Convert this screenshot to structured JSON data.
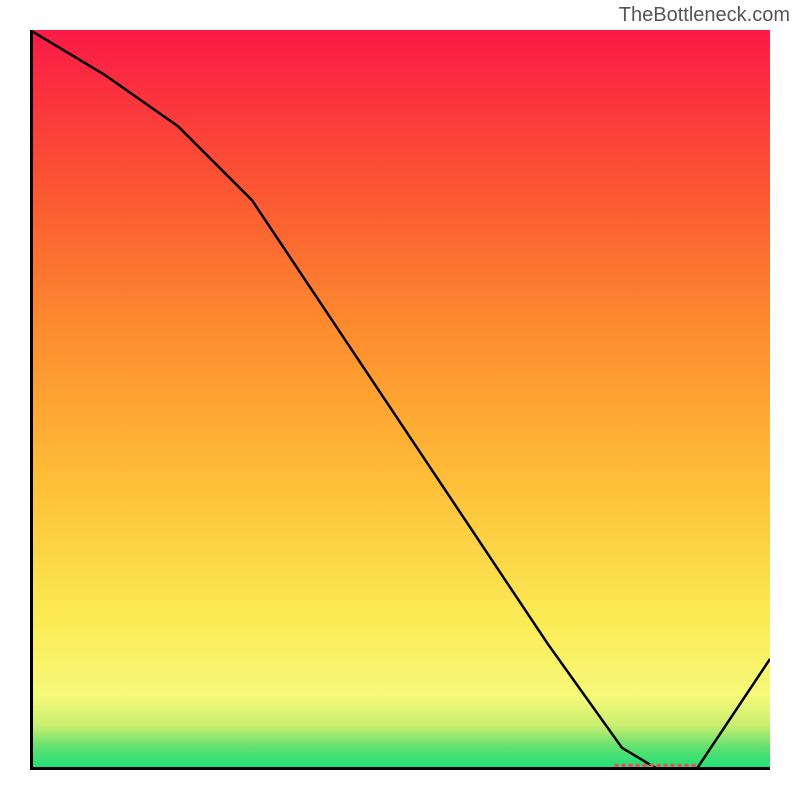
{
  "watermark": "TheBottleneck.com",
  "chart_data": {
    "type": "line",
    "title": "",
    "xlabel": "",
    "ylabel": "",
    "xlim": [
      0,
      100
    ],
    "ylim": [
      0,
      100
    ],
    "series": [
      {
        "name": "curve",
        "x": [
          0,
          10,
          20,
          30,
          40,
          50,
          60,
          70,
          75,
          80,
          85,
          90,
          100
        ],
        "values": [
          100,
          94,
          87,
          77,
          62,
          47,
          32,
          17,
          10,
          3,
          0,
          0,
          15
        ]
      },
      {
        "name": "minimum-marker",
        "x": [
          79,
          90
        ],
        "values": [
          0.5,
          0.5
        ]
      }
    ],
    "gradient_stops": [
      {
        "pos": 0.0,
        "color": "#19e07a"
      },
      {
        "pos": 0.03,
        "color": "#5ee070"
      },
      {
        "pos": 0.06,
        "color": "#c9ee70"
      },
      {
        "pos": 0.1,
        "color": "#f6f97a"
      },
      {
        "pos": 0.2,
        "color": "#fbec55"
      },
      {
        "pos": 0.4,
        "color": "#febc37"
      },
      {
        "pos": 0.6,
        "color": "#fd8b2e"
      },
      {
        "pos": 0.8,
        "color": "#fb5233"
      },
      {
        "pos": 1.0,
        "color": "#fa1a46"
      }
    ],
    "axis_stroke_width": 6,
    "curve_stroke_width": 2.5,
    "marker_color": "#f24a4a"
  }
}
